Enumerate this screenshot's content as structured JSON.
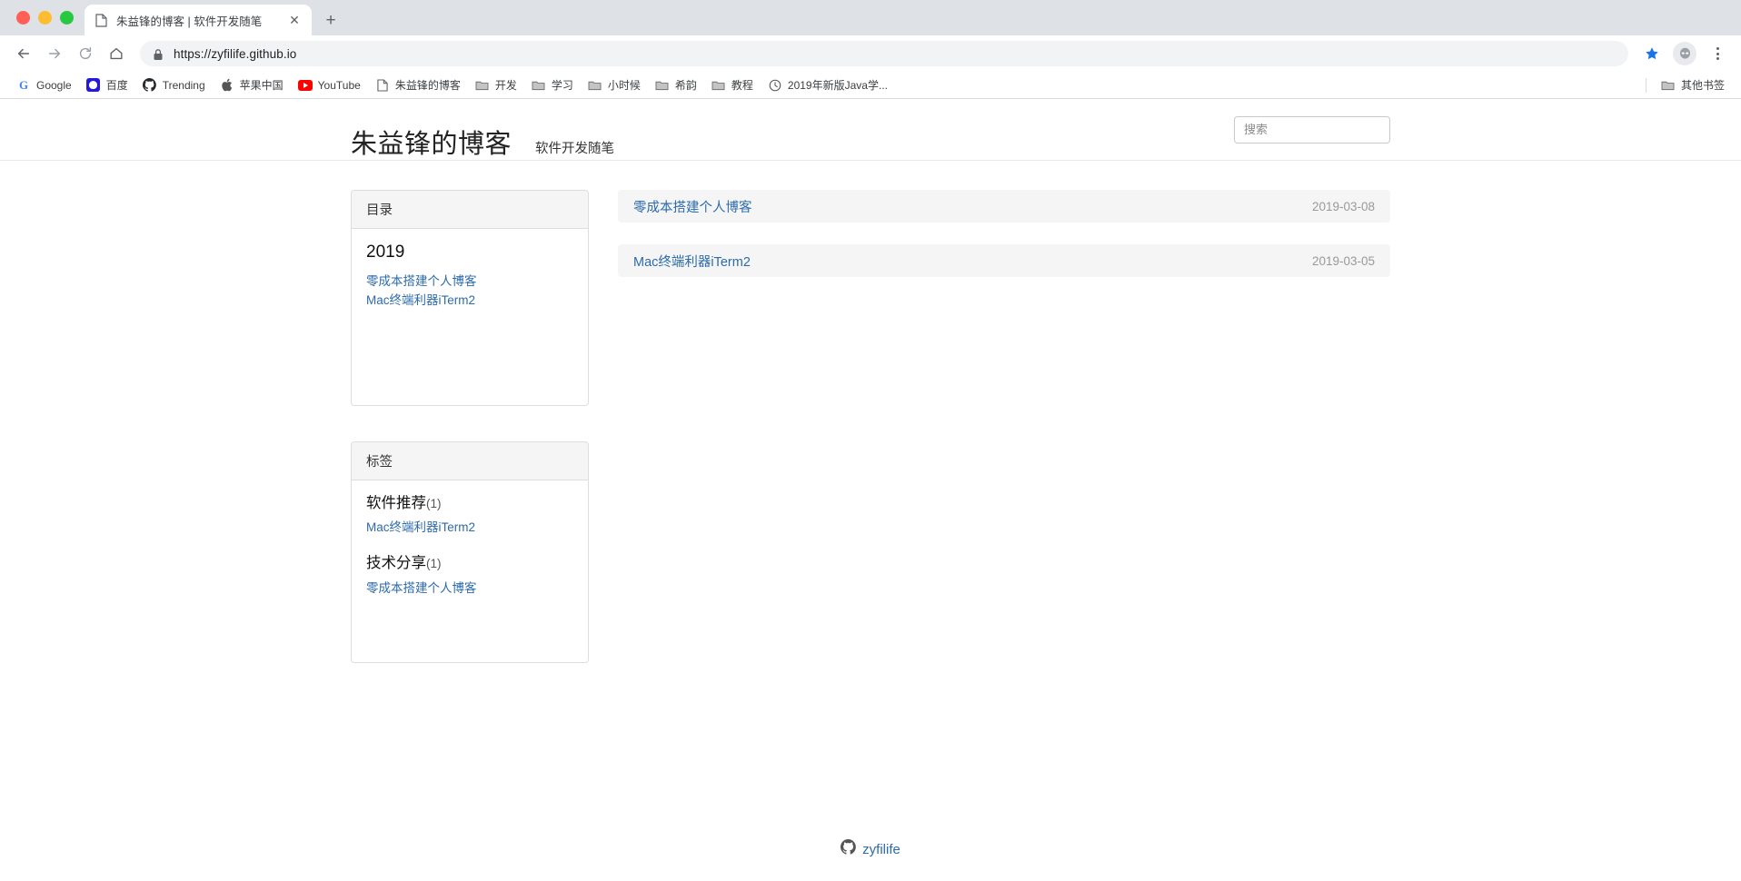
{
  "browser": {
    "tab": {
      "title": "朱益锋的博客 | 软件开发随笔",
      "favicon": "page-icon",
      "close_label": "✕"
    },
    "new_tab_label": "+",
    "nav": {
      "back": "back-arrow-icon",
      "forward": "forward-arrow-icon",
      "reload": "reload-icon",
      "home": "home-icon"
    },
    "omnibox": {
      "url": "https://zyfilife.github.io",
      "lock": "lock-icon"
    },
    "bookmarks": [
      {
        "label": "Google",
        "icon": "google-icon"
      },
      {
        "label": "百度",
        "icon": "baidu-icon"
      },
      {
        "label": "Trending",
        "icon": "github-icon"
      },
      {
        "label": "苹果中国",
        "icon": "apple-icon"
      },
      {
        "label": "YouTube",
        "icon": "youtube-icon"
      },
      {
        "label": "朱益锋的博客",
        "icon": "page-icon"
      },
      {
        "label": "开发",
        "icon": "folder-icon"
      },
      {
        "label": "学习",
        "icon": "folder-icon"
      },
      {
        "label": "小时候",
        "icon": "folder-icon"
      },
      {
        "label": "希韵",
        "icon": "folder-icon"
      },
      {
        "label": "教程",
        "icon": "folder-icon"
      },
      {
        "label": "2019年新版Java学...",
        "icon": "clock-icon"
      }
    ],
    "other_bookmarks": {
      "label": "其他书签",
      "icon": "folder-icon"
    }
  },
  "page": {
    "brand": "朱益锋的博客",
    "tagline": "软件开发随笔",
    "search_placeholder": "搜索",
    "search_value": "",
    "sidebar": {
      "directory": {
        "heading": "目录",
        "year": "2019",
        "links": [
          "零成本搭建个人博客",
          "Mac终端利器iTerm2"
        ]
      },
      "tags": {
        "heading": "标签",
        "groups": [
          {
            "name": "软件推荐",
            "count": "(1)",
            "links": [
              "Mac终端利器iTerm2"
            ]
          },
          {
            "name": "技术分享",
            "count": "(1)",
            "links": [
              "零成本搭建个人博客"
            ]
          }
        ]
      }
    },
    "posts": [
      {
        "title": "零成本搭建个人博客",
        "date": "2019-03-08"
      },
      {
        "title": "Mac终端利器iTerm2",
        "date": "2019-03-05"
      }
    ],
    "footer": {
      "text": "zyfilife",
      "icon": "github-icon"
    }
  },
  "colors": {
    "link": "#2d6bab",
    "row_bg": "#f5f5f5",
    "panel_head_bg": "#f5f5f5",
    "chrome_tabstrip": "#dee1e6",
    "star": "#1a73e8"
  }
}
